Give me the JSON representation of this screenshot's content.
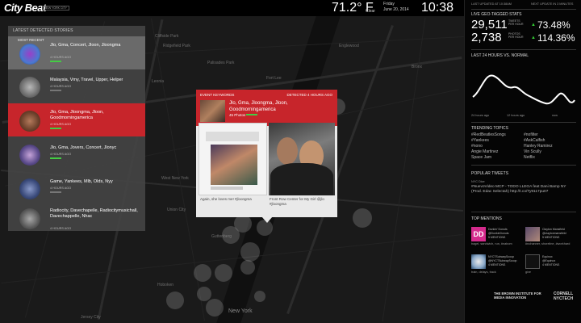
{
  "header": {
    "logo": "City Beat",
    "logo_badge": "NEW YORK CITY",
    "temperature": "71.2° F",
    "condition": "Clear",
    "day": "Friday",
    "date": "June 20, 2014",
    "time": "10:38 AM"
  },
  "map": {
    "labels": [
      "Cliffside Park",
      "Ridgefield Park",
      "Palisades Park",
      "Fort Lee",
      "Leonia",
      "Union City",
      "Hoboken",
      "Jersey City",
      "New York",
      "Bronx",
      "Guttenberg",
      "West New York",
      "Englewood"
    ]
  },
  "stories": {
    "title": "LATEST DETECTED STORIES",
    "recent_tag": "MOST RECENT",
    "items": [
      {
        "title": "Jlo, Gma, Concert, Jloon, Jloongma",
        "time": "4 HOURS AGO"
      },
      {
        "title": "Malaysia, Vmy, Travel, Upper, Helper",
        "time": "4 HOURS AGO"
      },
      {
        "title": "Jlo, Gma, Jloongma, Jloon, Goodmorningamerica",
        "time": "4 HOURS AGO"
      },
      {
        "title": "Jlo, Gma, Jovers, Concert, Jlonyc",
        "time": "4 HOURS AGO"
      },
      {
        "title": "Game, Yankees, Mlb, Olds, Nyy",
        "time": "4 HOURS AGO"
      },
      {
        "title": "Radiocity, Davechapelle, Radiocitymusichall, Davechappelle, Nhac",
        "time": "4 HOURS AGO"
      }
    ]
  },
  "popup": {
    "label": "EVENT KEYWORDS",
    "detected": "DETECTED 4 HOURS AGO",
    "title": "Jlo, Gma, Jloongma, Jloon, Goodmorningamerica",
    "photos": "45 Photos",
    "caption_left": "Again, she loves me! #jloongma",
    "caption_right": "Front Row Center for My Girl @jlo #jloongma"
  },
  "right": {
    "stats_header_left": "LAST UPDATED AT 10:38AM",
    "stats_header_right": "NEXT UPDATE IN 3 MINUTES",
    "geo_title": "LIVE GEO-TAGGED STATS",
    "tweets_count": "29,511",
    "tweets_label": "TWEETS PER HOUR",
    "tweets_pct": "73.48%",
    "photos_count": "2,738",
    "photos_label": "PHOTOS PER HOUR",
    "photos_pct": "114.36%",
    "chart_title": "LAST 24 HOURS VS. NORMAL",
    "chart_ticks": [
      "24 hours ago",
      "12 hours ago",
      "now"
    ],
    "trending_title": "TRENDING TOPICS",
    "trending_left": [
      "#RedBeatlesSongs",
      "#Yankees",
      "#nono",
      "Angie Martinez",
      "Space Jam"
    ],
    "trending_right": [
      "#nofilter",
      "#AskCalfish",
      "Hanley Ramirez",
      "Vin Scully",
      "Netflix"
    ],
    "tweets_title": "POPULAR TWEETS",
    "tweet_meta": "NYC Dice",
    "tweet_text": "#NuevoVideo MCP - TODO LLEGA feat Dani Bamp NY (Prod. Edac Selectah) http://t.co/Ty9117pu07",
    "mentions_title": "TOP MENTIONS",
    "mentions": [
      {
        "name": "Dunkin' Donuts",
        "handle": "@DunkinDonuts",
        "mentions": "5 MENTIONS",
        "desc": "bagel, sandwich, run, #nabom"
      },
      {
        "name": "Clayton Mansfield",
        "handle": "@claytonmansfield",
        "mentions": "5 MENTIONS",
        "desc": "#nohanner, shoreline, #workhard"
      },
      {
        "name": "NYCTSubwayScoop",
        "handle": "@NYCTSubwayScoop",
        "mentions": "4 MENTIONS",
        "desc": "train, delays, track"
      },
      {
        "name": "Equinox",
        "handle": "@Equinox",
        "mentions": "4 MENTIONS",
        "desc": "give"
      }
    ],
    "footer_left": "THE BROWN INSTITUTE FOR MEDIA INNOVATION",
    "footer_right": "CORNELL NYCTECH"
  },
  "colors": {
    "accent_red": "#c7252b",
    "up_green": "#33cc33",
    "background": "#0d0d0d"
  }
}
